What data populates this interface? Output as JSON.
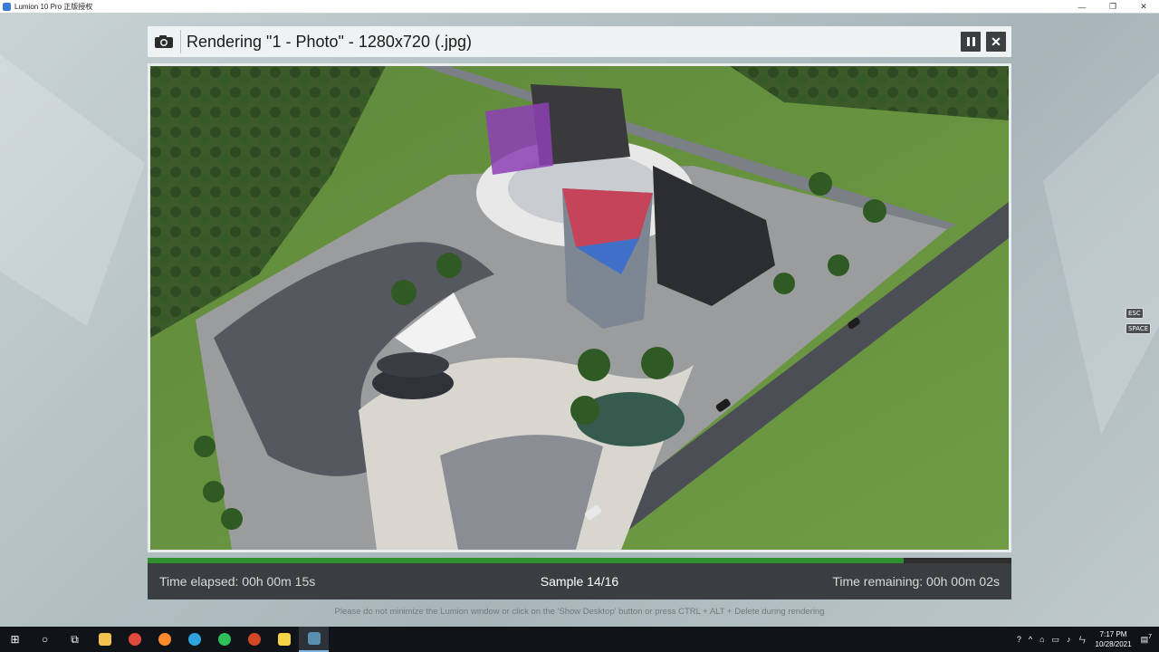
{
  "window": {
    "title": "Lumion 10 Pro 正版授权",
    "controls": [
      "—",
      "❐",
      "✕"
    ]
  },
  "dialog": {
    "title": "Rendering \"1 - Photo\" - 1280x720 (.jpg)",
    "pause_icon": "pause-icon",
    "close_icon": "close-icon",
    "close_glyph": "✕"
  },
  "progress": {
    "fraction": 0.875,
    "color": "#2f8f2f"
  },
  "status": {
    "elapsed": "Time elapsed: 00h 00m 15s",
    "sample": "Sample 14/16",
    "remaining": "Time remaining: 00h 00m 02s"
  },
  "notice": "Please do not minimize the Lumion window or click on the 'Show Desktop' button or press CTRL + ALT + Delete during rendering",
  "key_hints": {
    "esc": "ESC",
    "space": "SPACE"
  },
  "taskbar": {
    "items": [
      {
        "name": "start-button",
        "glyph": "⊞"
      },
      {
        "name": "search-button",
        "glyph": "○"
      },
      {
        "name": "task-view-button",
        "glyph": "⧉"
      },
      {
        "name": "file-explorer-icon",
        "color": "#f2c14e"
      },
      {
        "name": "chrome-icon",
        "color": "#e04b3c"
      },
      {
        "name": "firefox-icon",
        "color": "#ff8a2b"
      },
      {
        "name": "telegram-icon",
        "color": "#2ea3dd"
      },
      {
        "name": "whatsapp-icon",
        "color": "#2fbf5a"
      },
      {
        "name": "powerpoint-icon",
        "color": "#d24726"
      },
      {
        "name": "sticky-notes-icon",
        "color": "#f5d547"
      },
      {
        "name": "lumion-icon",
        "color": "#5b8fb0"
      }
    ],
    "tray": {
      "icons": [
        "help-icon",
        "chevron-up-icon",
        "network-icon",
        "battery-icon",
        "volume-icon",
        "ime-icon"
      ],
      "time": "7:17 PM",
      "date": "10/28/2021",
      "notifications": "7"
    }
  }
}
